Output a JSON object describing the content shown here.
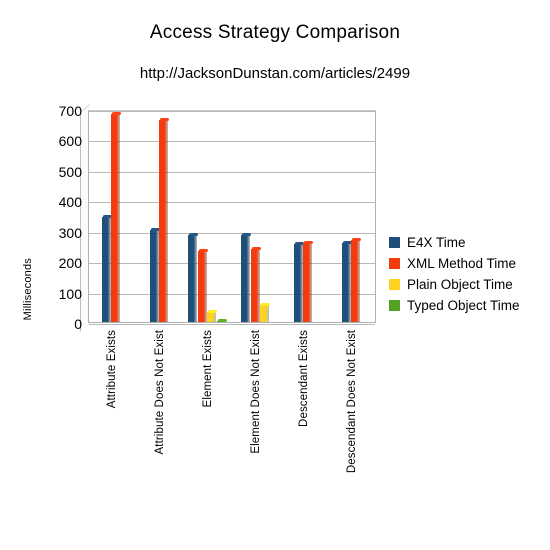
{
  "chart_data": {
    "type": "bar",
    "title": "Access Strategy Comparison",
    "subtitle": "http://JacksonDunstan.com/articles/2499",
    "xlabel": "",
    "ylabel": "Milliseconds",
    "ylim": [
      0,
      700
    ],
    "yticks": [
      0,
      100,
      200,
      300,
      400,
      500,
      600,
      700
    ],
    "grid": true,
    "legend_position": "right",
    "categories": [
      "Attribute Exists",
      "Attribute Does Not Exist",
      "Element Exists",
      "Element Does Not Exist",
      "Descendant Exists",
      "Descendant Does Not Exist"
    ],
    "series": [
      {
        "name": "E4X Time",
        "color": "#1F4E79",
        "values": [
          345,
          303,
          285,
          285,
          258,
          260
        ]
      },
      {
        "name": "XML Method Time",
        "color": "#F43B10",
        "values": [
          685,
          663,
          235,
          240,
          260,
          268
        ]
      },
      {
        "name": "Plain Object Time",
        "color": "#FFD320",
        "values": [
          0,
          0,
          33,
          55,
          0,
          0
        ]
      },
      {
        "name": "Typed Object Time",
        "color": "#54A021",
        "values": [
          0,
          0,
          4,
          0,
          0,
          0
        ]
      }
    ]
  }
}
